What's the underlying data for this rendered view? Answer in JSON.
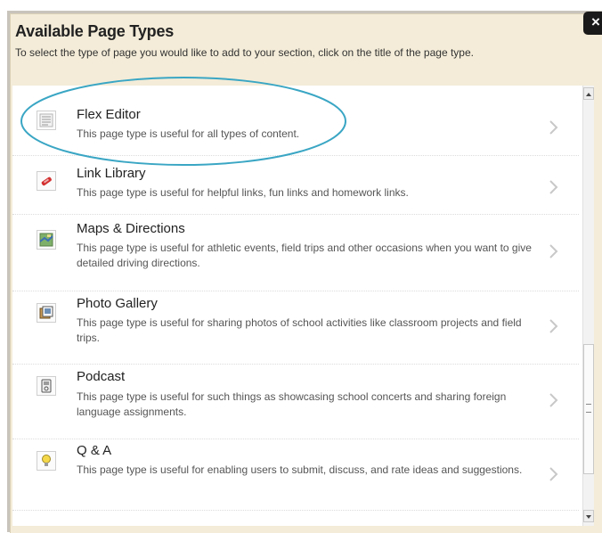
{
  "dialog": {
    "title": "Available Page Types",
    "subtitle": "To select the type of page you would like to add to your section, click on the title of the page type.",
    "close_label": "×"
  },
  "page_types": [
    {
      "title": "Flex Editor",
      "description": "This page type is useful for all types of content.",
      "icon": "document-lines-icon"
    },
    {
      "title": "Link Library",
      "description": "This page type is useful for helpful links, fun links and homework links.",
      "icon": "red-link-icon"
    },
    {
      "title": "Maps & Directions",
      "description": "This page type is useful for athletic events, field trips and other occasions when you want to give detailed driving directions.",
      "icon": "map-icon"
    },
    {
      "title": "Photo Gallery",
      "description": "This page type is useful for sharing photos of school activities like classroom projects and field trips.",
      "icon": "photo-gallery-icon"
    },
    {
      "title": "Podcast",
      "description": "This page type is useful for such things as showcasing school concerts and sharing foreign language assignments.",
      "icon": "podcast-player-icon"
    },
    {
      "title": "Q & A",
      "description": "This page type is useful for enabling users to submit, discuss, and rate ideas and suggestions.",
      "icon": "lightbulb-icon"
    }
  ],
  "colors": {
    "dialog_background": "#f4ecd8",
    "highlight_ellipse": "#3aa6c4"
  }
}
